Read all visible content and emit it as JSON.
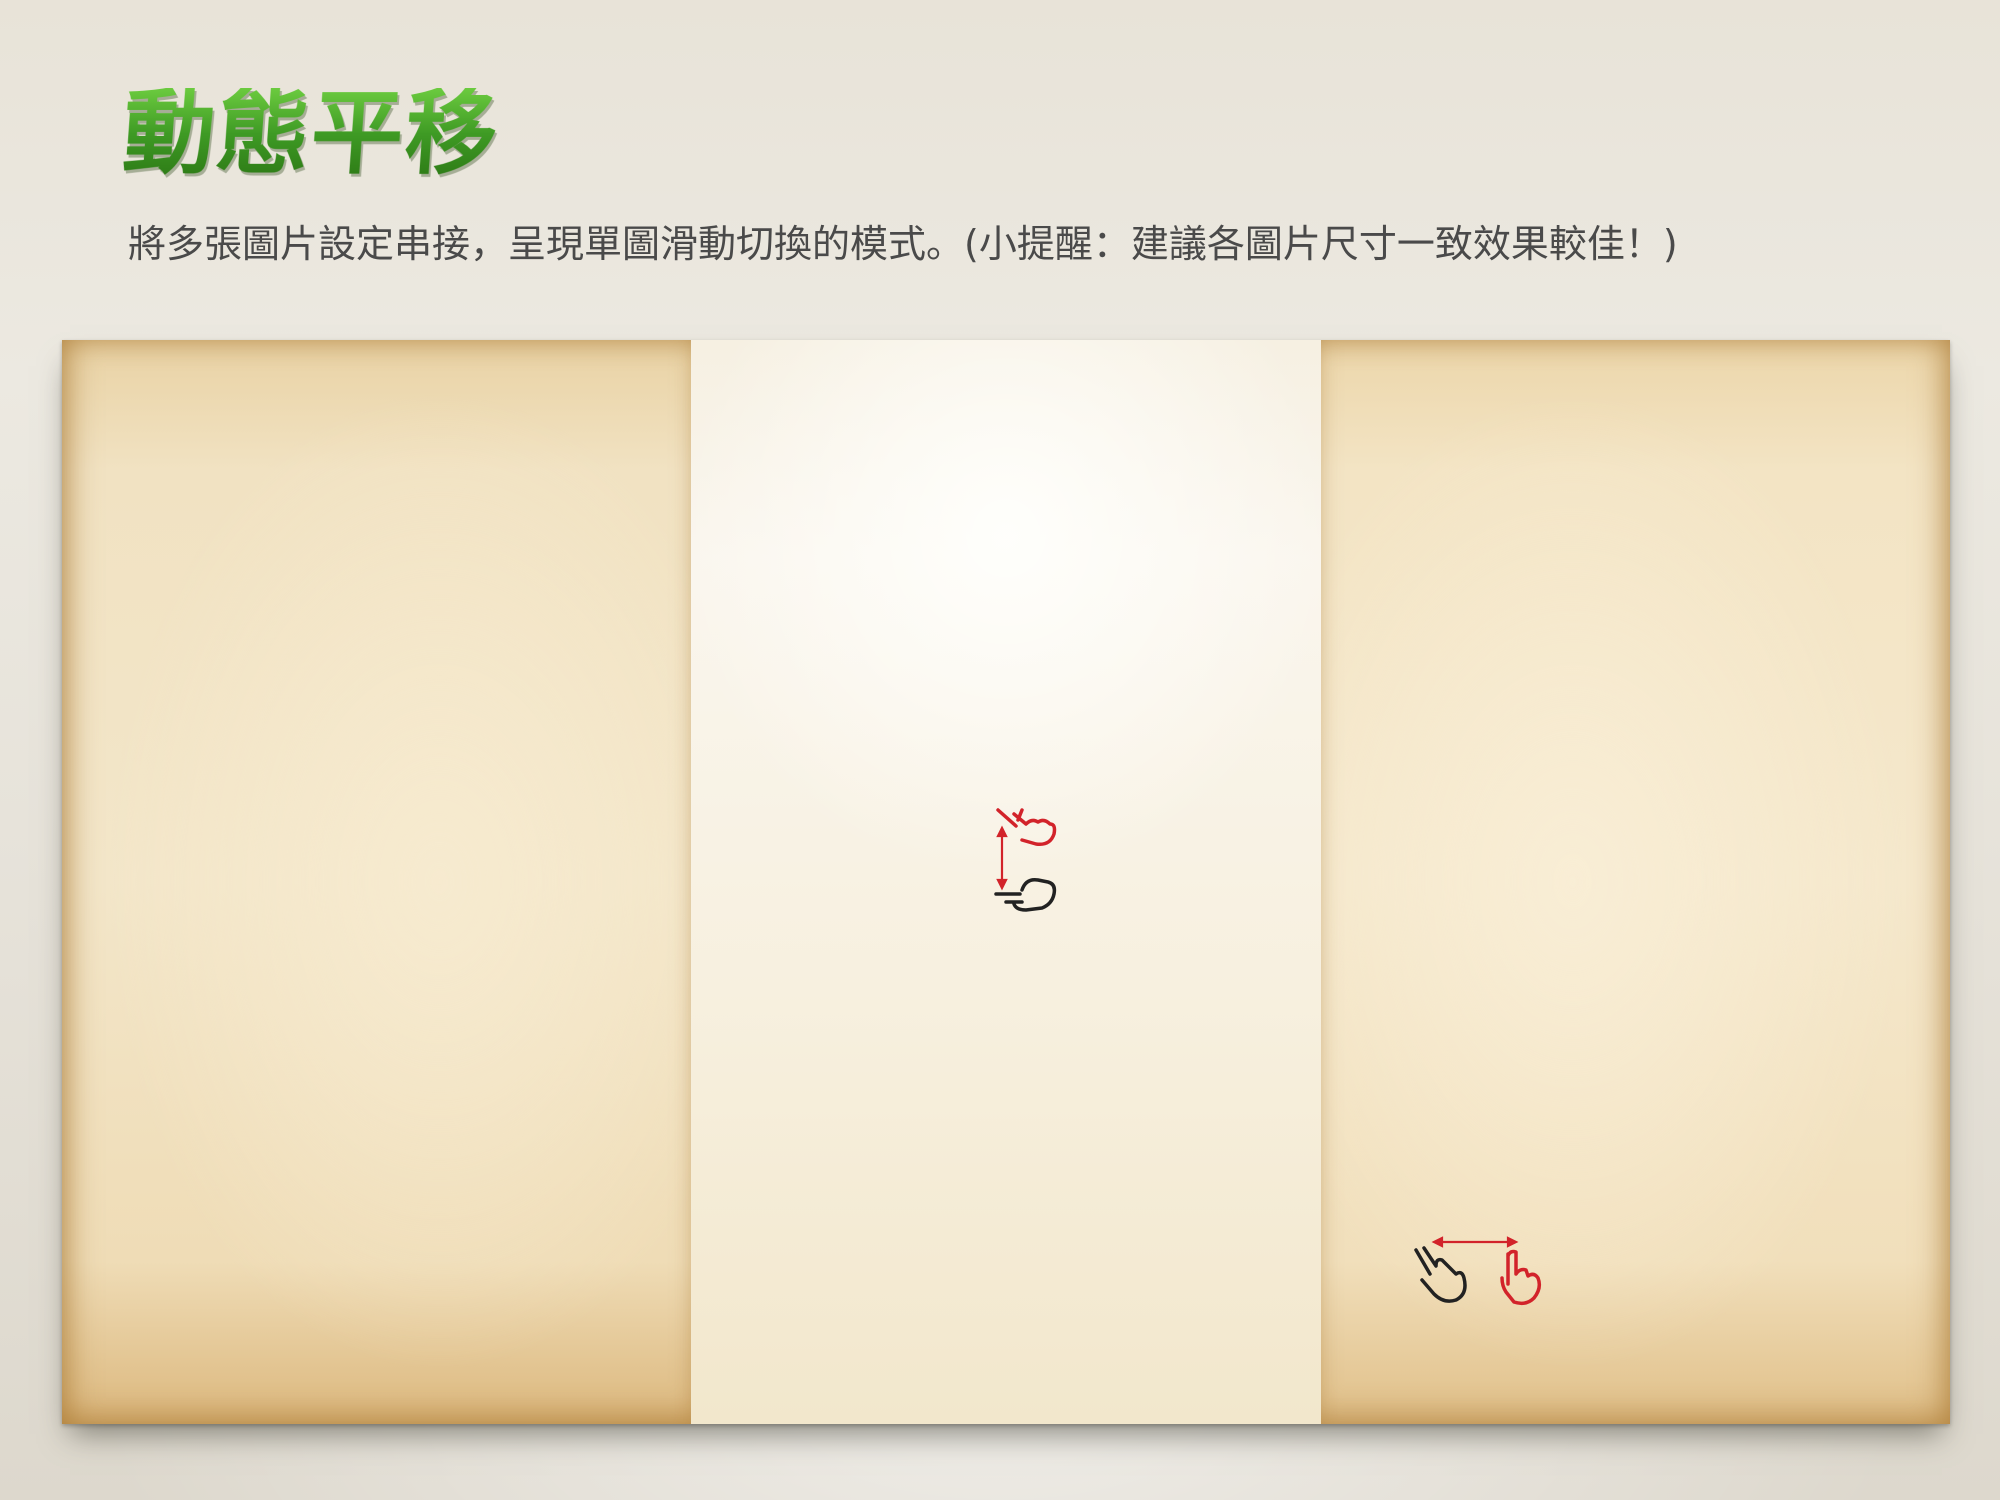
{
  "header": {
    "title": "動態平移",
    "description": "將多張圖片設定串接，呈現單圖滑動切換的模式。(小提醒：建議各圖片尺寸一致效果較佳！)"
  },
  "slideshow": {
    "slides": [
      "paper-left",
      "paper-middle",
      "paper-right"
    ],
    "icons": {
      "vertical_swipe": "swipe-vertical-icon",
      "horizontal_swipe": "swipe-horizontal-icon"
    }
  },
  "colors": {
    "title_green": "#3f9a28",
    "gesture_red": "#d2232a",
    "gesture_outline": "#222222"
  }
}
